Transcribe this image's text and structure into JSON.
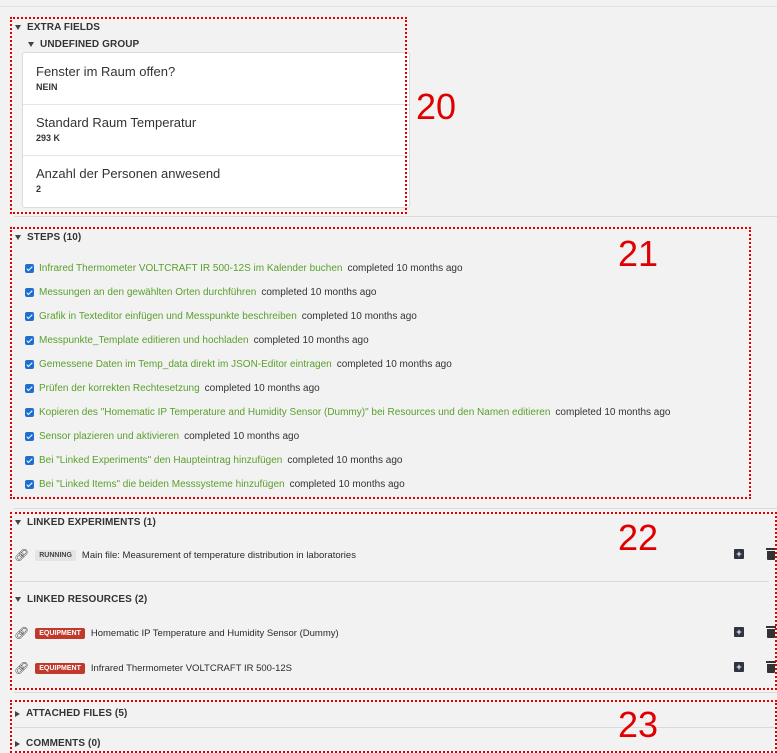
{
  "extra_fields": {
    "title": "EXTRA FIELDS",
    "group_title": "UNDEFINED GROUP",
    "fields": [
      {
        "label": "Fenster im Raum offen?",
        "value": "NEIN"
      },
      {
        "label": "Standard Raum Temperatur",
        "value": "293 K"
      },
      {
        "label": "Anzahl der Personen anwesend",
        "value": "2"
      }
    ]
  },
  "steps": {
    "title": "STEPS (10)",
    "items": [
      {
        "link": "Infrared Thermometer VOLTCRAFT IR 500-12S im Kalender buchen",
        "info": "completed 10 months ago"
      },
      {
        "link": "Messungen an den gewählten Orten durchführen",
        "info": "completed 10 months ago"
      },
      {
        "link": "Grafik in Texteditor einfügen und Messpunkte beschreiben",
        "info": "completed 10 months ago"
      },
      {
        "link": "Messpunkte_Template editieren und hochladen",
        "info": "completed 10 months ago"
      },
      {
        "link": "Gemessene Daten im Temp_data direkt im JSON-Editor eintragen",
        "info": "completed 10 months ago"
      },
      {
        "link": "Prüfen der korrekten Rechtesetzung",
        "info": "completed 10 months ago"
      },
      {
        "link": "Kopieren des \"Homematic IP Temperature and Humidity Sensor (Dummy)\" bei Resources und den Namen editieren",
        "info": "completed 10 months ago"
      },
      {
        "link": "Sensor plazieren und aktivieren",
        "info": "completed 10 months ago"
      },
      {
        "link": "Bei \"Linked Experiments\" den Haupteintrag hinzufügen",
        "info": "completed 10 months ago"
      },
      {
        "link": "Bei \"Linked Items\" die beiden Messsysteme hinzufügen",
        "info": "completed 10 months ago"
      }
    ]
  },
  "linked_experiments": {
    "title": "LINKED EXPERIMENTS (1)",
    "items": [
      {
        "badge": "RUNNING",
        "name": "Main file: Measurement of temperature distribution in laboratories"
      }
    ]
  },
  "linked_resources": {
    "title": "LINKED RESOURCES (2)",
    "items": [
      {
        "badge": "EQUIPMENT",
        "name": "Homematic IP Temperature and Humidity Sensor (Dummy)"
      },
      {
        "badge": "EQUIPMENT",
        "name": "Infrared Thermometer VOLTCRAFT IR 500-12S"
      }
    ]
  },
  "attached_files": {
    "title": "ATTACHED FILES (5)"
  },
  "comments": {
    "title": "COMMENTS (0)"
  },
  "annotations": {
    "a20": "20",
    "a21": "21",
    "a22": "22",
    "a23": "23"
  },
  "colors": {
    "link_green": "#5aa02c",
    "annotation_red": "#e00000",
    "equipment_badge": "#c0392b",
    "checkbox_blue": "#1f6fd0"
  },
  "icons": {
    "section_toggle": "caret-icon",
    "step_check": "checkbox-checked-icon",
    "link": "chain-link-icon",
    "add": "plus-square-icon",
    "delete": "trash-icon"
  }
}
